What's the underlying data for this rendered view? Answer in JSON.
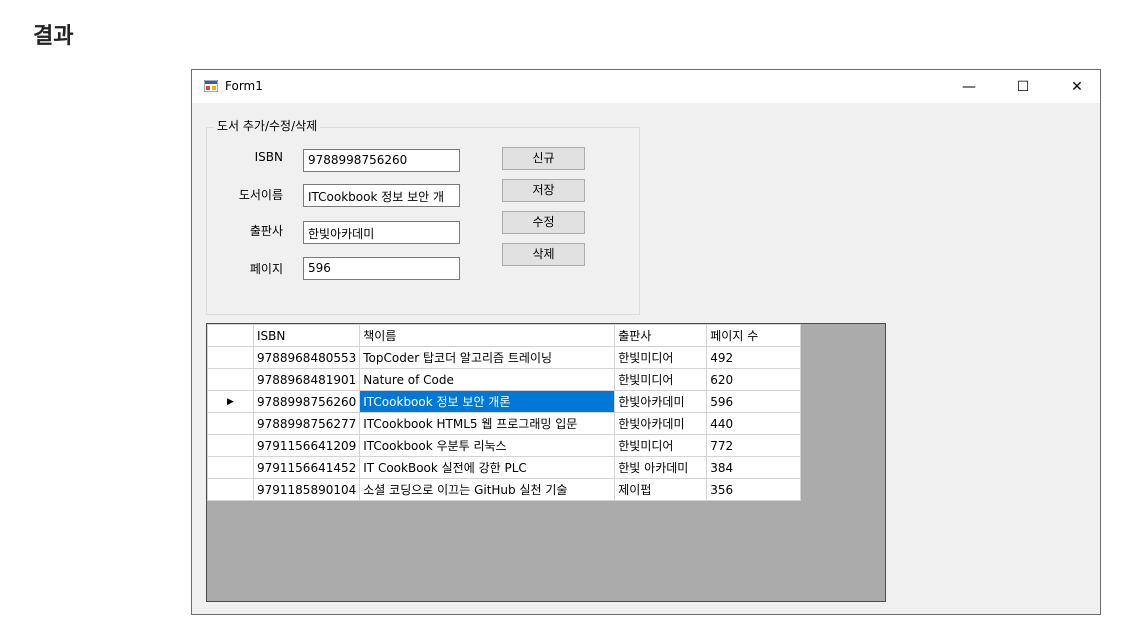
{
  "page_heading": "결과",
  "window": {
    "title": "Form1",
    "controls": {
      "minimize": "—",
      "maximize": "☐",
      "close": "✕"
    }
  },
  "group": {
    "legend": "도서 추가/수정/삭제",
    "fields": {
      "isbn": {
        "label": "ISBN",
        "value": "9788998756260"
      },
      "title": {
        "label": "도서이름",
        "value": "ITCookbook 정보 보안 개"
      },
      "publisher": {
        "label": "출판사",
        "value": "한빛아카데미"
      },
      "pages": {
        "label": "페이지",
        "value": "596"
      }
    },
    "buttons": {
      "new": "신규",
      "save": "저장",
      "edit": "수정",
      "delete": "삭제"
    }
  },
  "grid": {
    "columns": [
      "",
      "ISBN",
      "책이름",
      "출판사",
      "페이지 수"
    ],
    "selected_row_index": 2,
    "current_row_marker": "▶",
    "rows": [
      {
        "isbn": "9788968480553",
        "name": "TopCoder 탑코더 알고리즘 트레이닝",
        "publisher": "한빛미디어",
        "pages": "492"
      },
      {
        "isbn": "9788968481901",
        "name": "Nature of Code",
        "publisher": "한빛미디어",
        "pages": "620"
      },
      {
        "isbn": "9788998756260",
        "name": "ITCookbook 정보 보안 개론",
        "publisher": "한빛아카데미",
        "pages": "596"
      },
      {
        "isbn": "9788998756277",
        "name": "ITCookbook HTML5 웹 프로그래밍 입문",
        "publisher": "한빛아카데미",
        "pages": "440"
      },
      {
        "isbn": "9791156641209",
        "name": "ITCookbook 우분투 리눅스",
        "publisher": "한빛미디어",
        "pages": "772"
      },
      {
        "isbn": "9791156641452",
        "name": "IT CookBook 실전에 강한 PLC",
        "publisher": "한빛 아카데미",
        "pages": "384"
      },
      {
        "isbn": "9791185890104",
        "name": "소셜 코딩으로 이끄는 GitHub 실천 기술",
        "publisher": "제이펍",
        "pages": "356"
      }
    ]
  }
}
